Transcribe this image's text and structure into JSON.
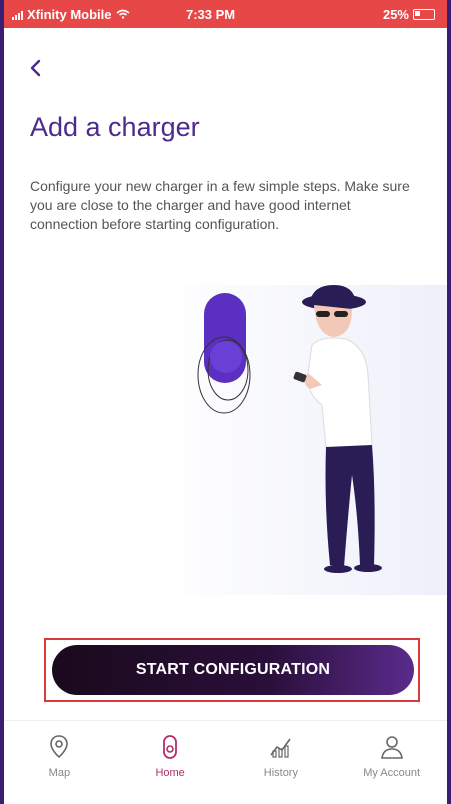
{
  "status_bar": {
    "carrier": "Xfinity Mobile",
    "time": "7:33 PM",
    "battery": "25%"
  },
  "page": {
    "title": "Add a charger",
    "description": "Configure your new charger in a few simple steps. Make sure you are close to the charger and have good internet connection before starting configuration."
  },
  "actions": {
    "start_label": "START CONFIGURATION"
  },
  "tabbar": {
    "items": [
      {
        "label": "Map",
        "icon": "map-icon",
        "active": false
      },
      {
        "label": "Home",
        "icon": "home-icon",
        "active": true
      },
      {
        "label": "History",
        "icon": "history-icon",
        "active": false
      },
      {
        "label": "My Account",
        "icon": "account-icon",
        "active": false
      }
    ]
  },
  "colors": {
    "accent": "#4b2b8c",
    "active_tab": "#b22d6b",
    "status_bar": "#e84747"
  }
}
